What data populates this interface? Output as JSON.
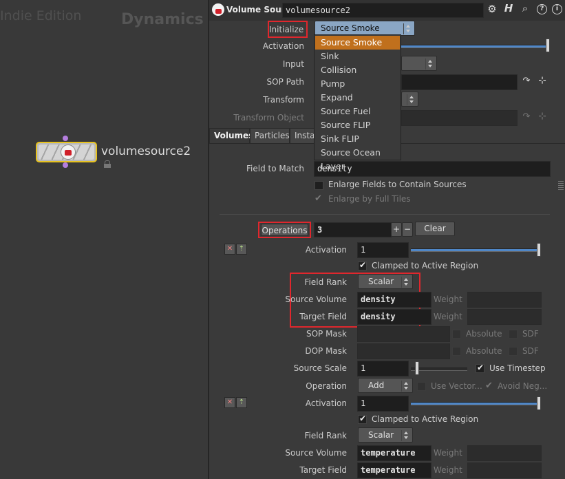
{
  "network": {
    "edition": "Indie Edition",
    "context": "Dynamics",
    "node_name": "volumesource2"
  },
  "header": {
    "node_type": "Volume Source",
    "node_name_value": "volumesource2",
    "icons": [
      "gear-icon",
      "houdini-help-icon",
      "search-icon",
      "help-icon",
      "info-icon"
    ]
  },
  "parms": {
    "initialize_label": "Initialize",
    "initialize_value": "Source Smoke",
    "activation_label": "Activation",
    "input_label": "Input",
    "sop_path_label": "SOP Path",
    "transform_label": "Transform",
    "transform_object_label": "Transform Object"
  },
  "dropdown": {
    "items": [
      "Source Smoke",
      "Sink",
      "Collision",
      "Pump",
      "Expand",
      "Source Fuel",
      "Source FLIP",
      "Sink FLIP",
      "Source Ocean Layer"
    ],
    "selected": "Source Smoke"
  },
  "tabs": [
    "Volumes",
    "Particles",
    "Instan"
  ],
  "volumes": {
    "field_to_match_label": "Field to Match",
    "field_to_match_value": "density",
    "enlarge_fields_label": "Enlarge Fields to Contain Sources",
    "enlarge_tiles_label": "Enlarge by Full Tiles",
    "operations_label": "Operations",
    "operations_value": "3",
    "plus_label": "+",
    "minus_label": "−",
    "clear_label": "Clear"
  },
  "op1": {
    "activation_label": "Activation",
    "activation_value": "1",
    "clamped_label": "Clamped to Active Region",
    "field_rank_label": "Field Rank",
    "field_rank_value": "Scalar",
    "source_volume_label": "Source Volume",
    "source_volume_value": "density",
    "target_field_label": "Target Field",
    "target_field_value": "density",
    "weight_label": "Weight",
    "sop_mask_label": "SOP Mask",
    "dop_mask_label": "DOP Mask",
    "absolute_label": "Absolute",
    "sdf_label": "SDF",
    "source_scale_label": "Source Scale",
    "source_scale_value": "1",
    "use_timestep_label": "Use Timestep",
    "operation_label": "Operation",
    "operation_value": "Add",
    "use_vector_label": "Use Vector...",
    "avoid_neg_label": "Avoid Neg..."
  },
  "op2": {
    "activation_label": "Activation",
    "activation_value": "1",
    "clamped_label": "Clamped to Active Region",
    "field_rank_label": "Field Rank",
    "field_rank_value": "Scalar",
    "source_volume_label": "Source Volume",
    "source_volume_value": "temperature",
    "target_field_label": "Target Field",
    "target_field_value": "temperature",
    "weight_label": "Weight"
  },
  "colors": {
    "highlight_box": "#e0272d",
    "menu_selection": "#c0701d",
    "slider": "#4f87c8",
    "node_border": "#e7c321"
  }
}
